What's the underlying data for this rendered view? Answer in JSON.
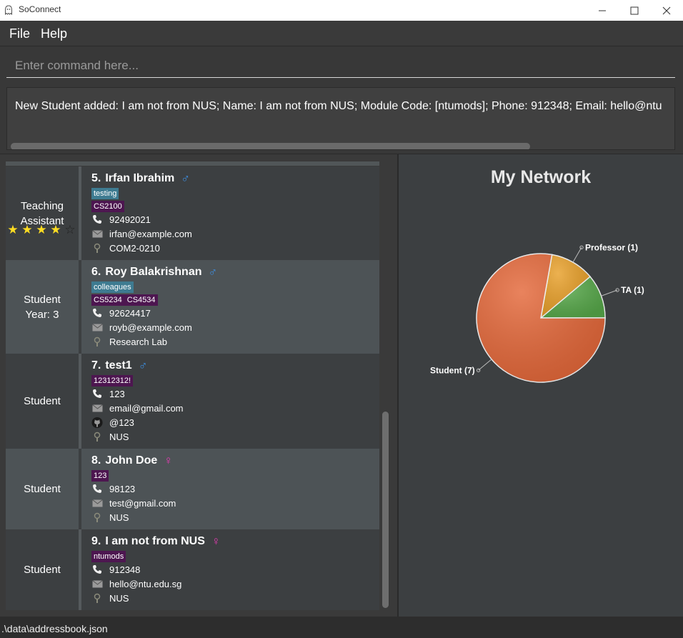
{
  "window": {
    "title": "SoConnect"
  },
  "menu": {
    "file": "File",
    "help": "Help"
  },
  "command": {
    "placeholder": "Enter command here..."
  },
  "result": {
    "text": "New Student added: I am not from NUS; Name: I am not from NUS; Module Code: [ntumods]; Phone: 912348; Email: hello@ntu"
  },
  "persons": [
    {
      "index": "5.",
      "name": "Irfan Ibrahim",
      "gender": "male",
      "role_line1": "Teaching",
      "role_line2": "Assistant",
      "rating": 4,
      "rating_max": 5,
      "tags_blue": [
        "testing"
      ],
      "tags_purple": [
        "CS2100"
      ],
      "phone": "92492021",
      "email": "irfan@example.com",
      "office": "COM2-0210"
    },
    {
      "index": "6.",
      "name": "Roy Balakrishnan",
      "gender": "male",
      "role_line1": "Student",
      "role_line2": "Year: 3",
      "tags_blue": [
        "colleagues"
      ],
      "tags_purple": [
        "CS5234",
        "CS4534"
      ],
      "phone": "92624417",
      "email": "royb@example.com",
      "office": "Research Lab"
    },
    {
      "index": "7.",
      "name": "test1",
      "gender": "male",
      "role_line1": "Student",
      "tags_purple": [
        "12312312!"
      ],
      "phone": "123",
      "email": "email@gmail.com",
      "github": "@123",
      "office": "NUS"
    },
    {
      "index": "8.",
      "name": "John Doe",
      "gender": "female",
      "role_line1": "Student",
      "tags_purple": [
        "123"
      ],
      "phone": "98123",
      "email": "test@gmail.com",
      "office": "NUS"
    },
    {
      "index": "9.",
      "name": "I am not from NUS",
      "gender": "female",
      "role_line1": "Student",
      "tags_purple": [
        "ntumods"
      ],
      "phone": "912348",
      "email": "hello@ntu.edu.sg",
      "office": "NUS"
    }
  ],
  "gender_symbols": {
    "male": "♂",
    "female": "♀"
  },
  "chart_data": {
    "type": "pie",
    "title": "My Network",
    "slices": [
      {
        "label": "TA (1)",
        "value": 1,
        "color": "#57a84a"
      },
      {
        "label": "Professor (1)",
        "value": 1,
        "color": "#e8a02a"
      },
      {
        "label": "Student (7)",
        "value": 7,
        "color": "#e4683a"
      }
    ]
  },
  "status": {
    "path": ".\\data\\addressbook.json"
  },
  "colors": {
    "male": "#3d8ee0",
    "female": "#e23cb1",
    "tag_blue": "#3e7b91",
    "tag_purple": "#4d1650",
    "star": "#ffdd22"
  }
}
